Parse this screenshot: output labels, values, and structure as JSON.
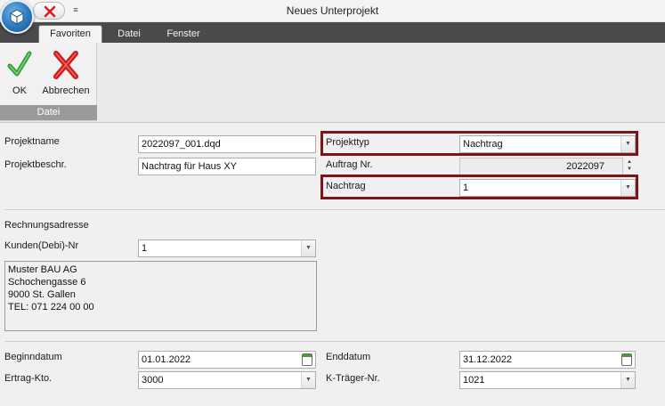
{
  "window": {
    "title": "Neues Unterprojekt",
    "qat_dropdown": "≡"
  },
  "tabs": [
    {
      "label": "Favoriten",
      "active": true
    },
    {
      "label": "Datei",
      "active": false
    },
    {
      "label": "Fenster",
      "active": false
    }
  ],
  "ribbon": {
    "ok_label": "OK",
    "cancel_label": "Abbrechen",
    "group_label": "Datei",
    "icons": {
      "ok": "checkmark-icon",
      "cancel": "red-x-icon"
    }
  },
  "form": {
    "projektname_label": "Projektname",
    "projektname_value": "2022097_001.dqd",
    "projektbeschr_label": "Projektbeschr.",
    "projektbeschr_value": "Nachtrag für Haus XY",
    "projekttyp_label": "Projekttyp",
    "projekttyp_value": "Nachtrag",
    "auftrag_label": "Auftrag Nr.",
    "auftrag_value": "2022097",
    "nachtrag_label": "Nachtrag",
    "nachtrag_value": "1",
    "rechnungsadresse_label": "Rechnungsadresse",
    "kunden_label": "Kunden(Debi)-Nr",
    "kunden_value": "1",
    "address_lines": [
      "Muster BAU AG",
      "Schochengasse 6",
      "9000 St. Gallen",
      "TEL: 071 224 00 00"
    ],
    "beginndatum_label": "Beginndatum",
    "beginndatum_value": "01.01.2022",
    "enddatum_label": "Enddatum",
    "enddatum_value": "31.12.2022",
    "ertrag_label": "Ertrag-Kto.",
    "ertrag_value": "3000",
    "ktraeger_label": "K-Träger-Nr.",
    "ktraeger_value": "1021"
  },
  "colors": {
    "highlight": "#7b1518",
    "tabstrip": "#4a4a4a",
    "group_label_bg": "#9a9a9a"
  }
}
